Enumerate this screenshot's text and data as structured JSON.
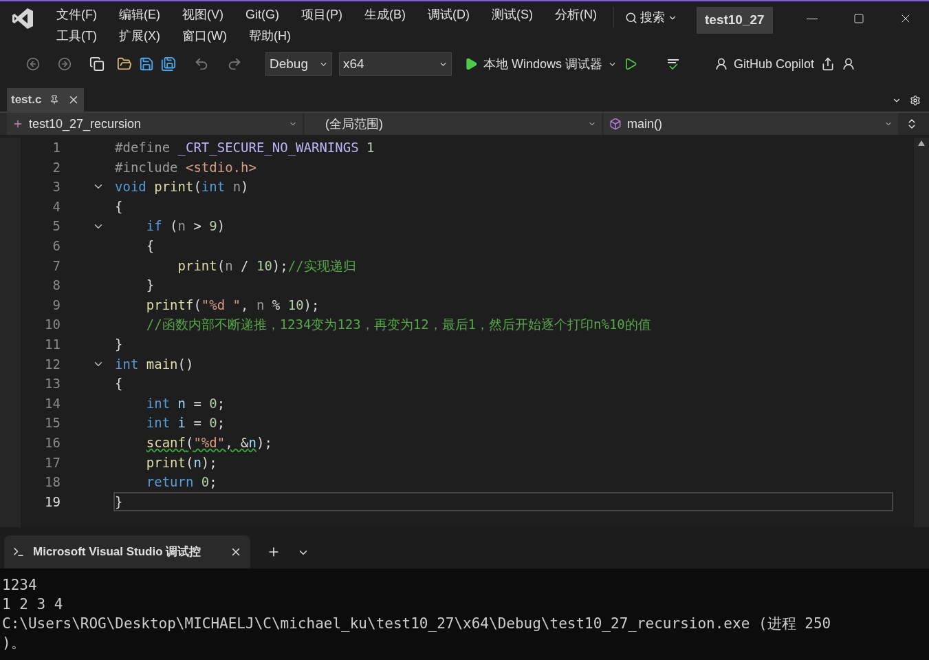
{
  "menu": {
    "rows": [
      [
        "文件(F)",
        "编辑(E)",
        "视图(V)",
        "Git(G)",
        "项目(P)",
        "生成(B)",
        "调试(D)",
        "测试(S)",
        "分析(N)"
      ],
      [
        "工具(T)",
        "扩展(X)",
        "窗口(W)",
        "帮助(H)"
      ]
    ]
  },
  "search": {
    "label": "搜索"
  },
  "solution": "test10_27",
  "toolbar": {
    "configuration": "Debug",
    "platform": "x64",
    "run": "本地 Windows 调试器",
    "copilot": "GitHub Copilot"
  },
  "tabs": [
    {
      "label": "test.c",
      "selected": true
    }
  ],
  "nav": {
    "project": "test10_27_recursion",
    "scope": "(全局范围)",
    "member": "main()"
  },
  "code": [
    {
      "number": "1",
      "current": false,
      "fold": false,
      "tokens": [
        {
          "kind": "pre",
          "text": "#define "
        },
        {
          "kind": "macro",
          "text": "_CRT_SECURE_NO_WARNINGS"
        },
        {
          "kind": "num",
          "text": " 1"
        }
      ]
    },
    {
      "number": "2",
      "current": false,
      "fold": false,
      "tokens": [
        {
          "kind": "pre",
          "text": "#include "
        },
        {
          "kind": "str",
          "text": "<stdio.h>"
        }
      ]
    },
    {
      "number": "3",
      "current": false,
      "fold": true,
      "tokens": [
        {
          "kind": "kw",
          "text": "void "
        },
        {
          "kind": "fn",
          "text": "print"
        },
        {
          "kind": "plain",
          "text": "("
        },
        {
          "kind": "kw",
          "text": "int "
        },
        {
          "kind": "param",
          "text": "n"
        },
        {
          "kind": "plain",
          "text": ")"
        }
      ]
    },
    {
      "number": "4",
      "current": false,
      "fold": false,
      "tokens": [
        {
          "kind": "plain",
          "text": "{"
        }
      ]
    },
    {
      "number": "5",
      "current": false,
      "fold": true,
      "tokens": [
        {
          "kind": "kw",
          "text": "    if "
        },
        {
          "kind": "plain",
          "text": "("
        },
        {
          "kind": "param",
          "text": "n"
        },
        {
          "kind": "plain",
          "text": " > "
        },
        {
          "kind": "num",
          "text": "9"
        },
        {
          "kind": "plain",
          "text": ")"
        }
      ]
    },
    {
      "number": "6",
      "current": false,
      "fold": false,
      "tokens": [
        {
          "kind": "plain",
          "text": "    {"
        }
      ]
    },
    {
      "number": "7",
      "current": false,
      "fold": false,
      "tokens": [
        {
          "kind": "fn",
          "text": "        print"
        },
        {
          "kind": "plain",
          "text": "("
        },
        {
          "kind": "param",
          "text": "n"
        },
        {
          "kind": "plain",
          "text": " / "
        },
        {
          "kind": "num",
          "text": "10"
        },
        {
          "kind": "plain",
          "text": ");"
        },
        {
          "kind": "comment",
          "text": "//实现递归"
        }
      ]
    },
    {
      "number": "8",
      "current": false,
      "fold": false,
      "tokens": [
        {
          "kind": "plain",
          "text": "    }"
        }
      ]
    },
    {
      "number": "9",
      "current": false,
      "fold": false,
      "tokens": [
        {
          "kind": "fn",
          "text": "    printf"
        },
        {
          "kind": "plain",
          "text": "("
        },
        {
          "kind": "str",
          "text": "\"%d \""
        },
        {
          "kind": "plain",
          "text": ", "
        },
        {
          "kind": "param",
          "text": "n"
        },
        {
          "kind": "plain",
          "text": " % "
        },
        {
          "kind": "num",
          "text": "10"
        },
        {
          "kind": "plain",
          "text": ");"
        }
      ]
    },
    {
      "number": "10",
      "current": false,
      "fold": false,
      "tokens": [
        {
          "kind": "comment",
          "text": "    //函数内部不断递推，1234变为123，再变为12，最后1，然后开始逐个打印n%10的值"
        }
      ]
    },
    {
      "number": "11",
      "current": false,
      "fold": false,
      "tokens": [
        {
          "kind": "plain",
          "text": "}"
        }
      ]
    },
    {
      "number": "12",
      "current": false,
      "fold": true,
      "tokens": [
        {
          "kind": "kw",
          "text": "int "
        },
        {
          "kind": "fn",
          "text": "main"
        },
        {
          "kind": "plain",
          "text": "()"
        }
      ]
    },
    {
      "number": "13",
      "current": false,
      "fold": false,
      "tokens": [
        {
          "kind": "plain",
          "text": "{"
        }
      ]
    },
    {
      "number": "14",
      "current": false,
      "fold": false,
      "tokens": [
        {
          "kind": "kw",
          "text": "    int "
        },
        {
          "kind": "var",
          "text": "n"
        },
        {
          "kind": "plain",
          "text": " = "
        },
        {
          "kind": "num",
          "text": "0"
        },
        {
          "kind": "plain",
          "text": ";"
        }
      ]
    },
    {
      "number": "15",
      "current": false,
      "fold": false,
      "tokens": [
        {
          "kind": "kw",
          "text": "    int "
        },
        {
          "kind": "var",
          "text": "i"
        },
        {
          "kind": "plain",
          "text": " = "
        },
        {
          "kind": "num",
          "text": "0"
        },
        {
          "kind": "plain",
          "text": ";"
        }
      ]
    },
    {
      "number": "16",
      "current": false,
      "fold": false,
      "tokens": [
        {
          "kind": "fn",
          "text": "scanf",
          "indent": true,
          "warning": true
        },
        {
          "kind": "plain",
          "text": "(",
          "warning": true
        },
        {
          "kind": "str",
          "text": "\"%d\"",
          "warning": true
        },
        {
          "kind": "plain",
          "text": ", &",
          "warning": true
        },
        {
          "kind": "var",
          "text": "n",
          "warning": true
        },
        {
          "kind": "plain",
          "text": ");"
        }
      ]
    },
    {
      "number": "17",
      "current": false,
      "fold": false,
      "tokens": [
        {
          "kind": "fn",
          "text": "    print"
        },
        {
          "kind": "plain",
          "text": "("
        },
        {
          "kind": "var",
          "text": "n"
        },
        {
          "kind": "plain",
          "text": ");"
        }
      ]
    },
    {
      "number": "18",
      "current": false,
      "fold": false,
      "tokens": [
        {
          "kind": "kw",
          "text": "    return "
        },
        {
          "kind": "num",
          "text": "0"
        },
        {
          "kind": "plain",
          "text": ";"
        }
      ]
    },
    {
      "number": "19",
      "current": true,
      "fold": false,
      "tokens": [
        {
          "kind": "plain",
          "text": "}"
        }
      ]
    }
  ],
  "terminal": {
    "tab": "Microsoft Visual Studio 调试控",
    "lines": [
      "1234",
      "1 2 3 4",
      "C:\\Users\\ROG\\Desktop\\MICHAELJ\\C\\michael_ku\\test10_27\\x64\\Debug\\test10_27_recursion.exe (进程 250",
      ")。"
    ]
  }
}
